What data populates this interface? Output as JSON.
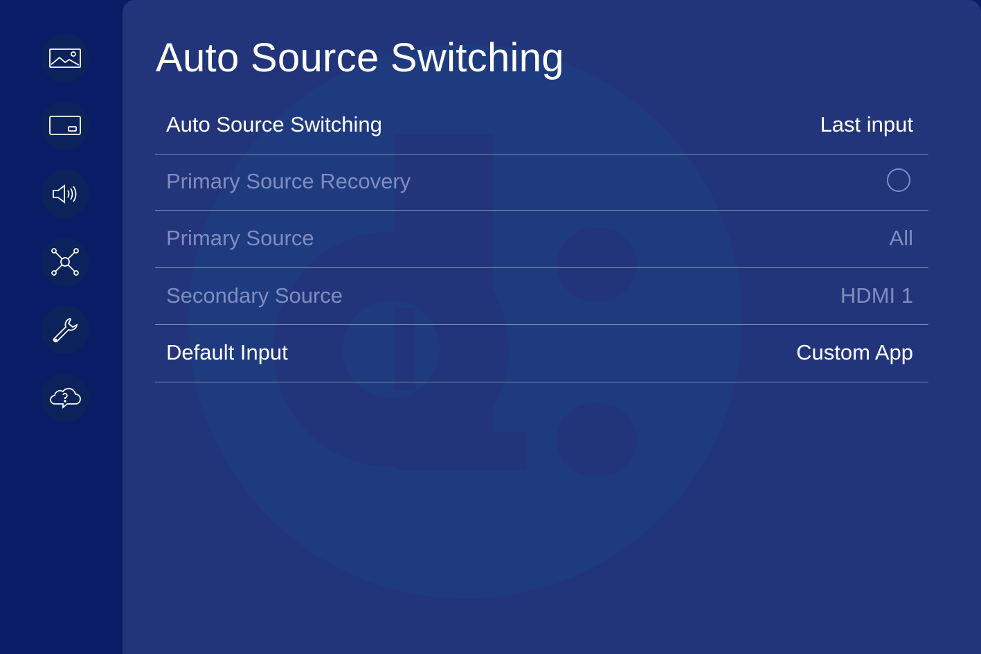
{
  "page": {
    "title": "Auto Source Switching"
  },
  "sidebar": {
    "items": [
      {
        "icon": "picture-icon"
      },
      {
        "icon": "screen-icon"
      },
      {
        "icon": "speaker-icon"
      },
      {
        "icon": "network-icon"
      },
      {
        "icon": "wrench-icon"
      },
      {
        "icon": "cloud-help-icon"
      }
    ]
  },
  "settings": [
    {
      "label": "Auto Source Switching",
      "value": "Last input",
      "enabled": true
    },
    {
      "label": "Primary Source Recovery",
      "value": "",
      "toggle": "off",
      "enabled": false
    },
    {
      "label": "Primary Source",
      "value": "All",
      "enabled": false
    },
    {
      "label": "Secondary Source",
      "value": "HDMI 1",
      "enabled": false
    },
    {
      "label": "Default Input",
      "value": "Custom App",
      "enabled": true
    }
  ],
  "colors": {
    "sidebar_bg": "#0a1c66",
    "panel_bg": "#22357a",
    "text_enabled": "#ffffff",
    "text_disabled": "#7f8dbf",
    "divider": "#aab4d8"
  }
}
